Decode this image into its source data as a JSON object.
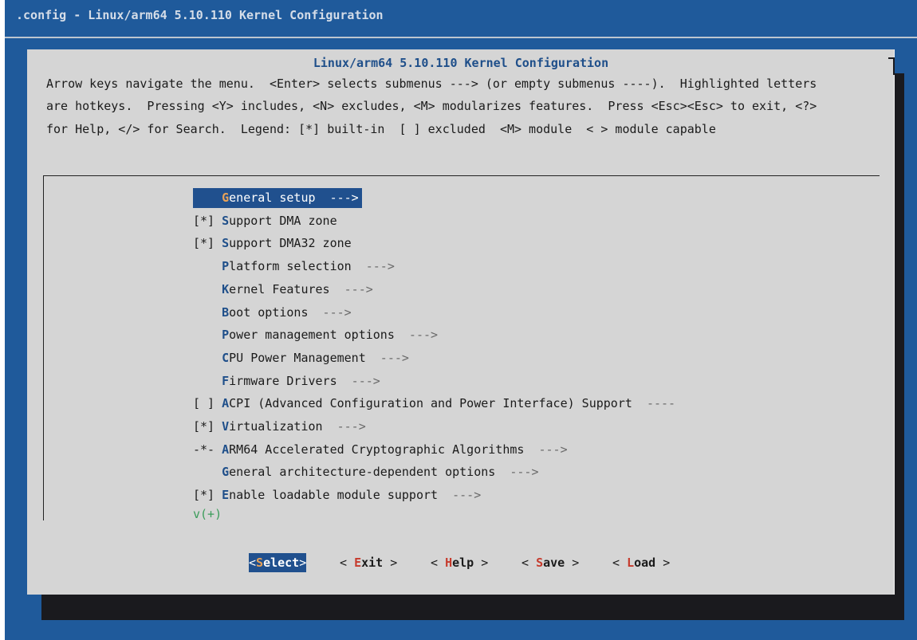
{
  "window": {
    "title": ".config - Linux/arm64 5.10.110 Kernel Configuration"
  },
  "dialog": {
    "title": "Linux/arm64 5.10.110 Kernel Configuration",
    "help_lines": [
      "Arrow keys navigate the menu.  <Enter> selects submenus ---> (or empty submenus ----).  Highlighted letters",
      "are hotkeys.  Pressing <Y> includes, <N> excludes, <M> modularizes features.  Press <Esc><Esc> to exit, <?>",
      "for Help, </> for Search.  Legend: [*] built-in  [ ] excluded  <M> module  < > module capable"
    ]
  },
  "menu": {
    "items": [
      {
        "prefix": "    ",
        "hotkey": "G",
        "rest": "eneral setup",
        "arrow": "  --->",
        "selected": true
      },
      {
        "prefix": "[*] ",
        "hotkey": "S",
        "rest": "upport DMA zone",
        "arrow": "",
        "selected": false
      },
      {
        "prefix": "[*] ",
        "hotkey": "S",
        "rest": "upport DMA32 zone",
        "arrow": "",
        "selected": false
      },
      {
        "prefix": "    ",
        "hotkey": "P",
        "rest": "latform selection",
        "arrow": "  --->",
        "selected": false
      },
      {
        "prefix": "    ",
        "hotkey": "K",
        "rest": "ernel Features",
        "arrow": "  --->",
        "selected": false
      },
      {
        "prefix": "    ",
        "hotkey": "B",
        "rest": "oot options",
        "arrow": "  --->",
        "selected": false
      },
      {
        "prefix": "    ",
        "hotkey": "P",
        "rest": "ower management options",
        "arrow": "  --->",
        "selected": false
      },
      {
        "prefix": "    ",
        "hotkey": "C",
        "rest": "PU Power Management",
        "arrow": "  --->",
        "selected": false
      },
      {
        "prefix": "    ",
        "hotkey": "F",
        "rest": "irmware Drivers",
        "arrow": "  --->",
        "selected": false
      },
      {
        "prefix": "[ ] ",
        "hotkey": "A",
        "rest": "CPI (Advanced Configuration and Power Interface) Support",
        "arrow": "  ----",
        "selected": false
      },
      {
        "prefix": "[*] ",
        "hotkey": "V",
        "rest": "irtualization",
        "arrow": "  --->",
        "selected": false
      },
      {
        "prefix": "-*- ",
        "hotkey": "A",
        "rest": "RM64 Accelerated Cryptographic Algorithms",
        "arrow": "  --->",
        "selected": false
      },
      {
        "prefix": "    ",
        "hotkey": "G",
        "rest": "eneral architecture-dependent options",
        "arrow": "  --->",
        "selected": false
      },
      {
        "prefix": "[*] ",
        "hotkey": "E",
        "rest": "nable loadable module support",
        "arrow": "  --->",
        "selected": false
      }
    ],
    "more_indicator": "v(+)"
  },
  "buttons": [
    {
      "open": "<",
      "hotkey": "S",
      "rest": "elect",
      "close": ">",
      "active": true
    },
    {
      "open": "< ",
      "hotkey": "E",
      "rest": "xit",
      "close": " >",
      "active": false
    },
    {
      "open": "< ",
      "hotkey": "H",
      "rest": "elp",
      "close": " >",
      "active": false
    },
    {
      "open": "< ",
      "hotkey": "S",
      "rest": "ave",
      "close": " >",
      "active": false
    },
    {
      "open": "< ",
      "hotkey": "L",
      "rest": "oad",
      "close": " >",
      "active": false
    }
  ]
}
